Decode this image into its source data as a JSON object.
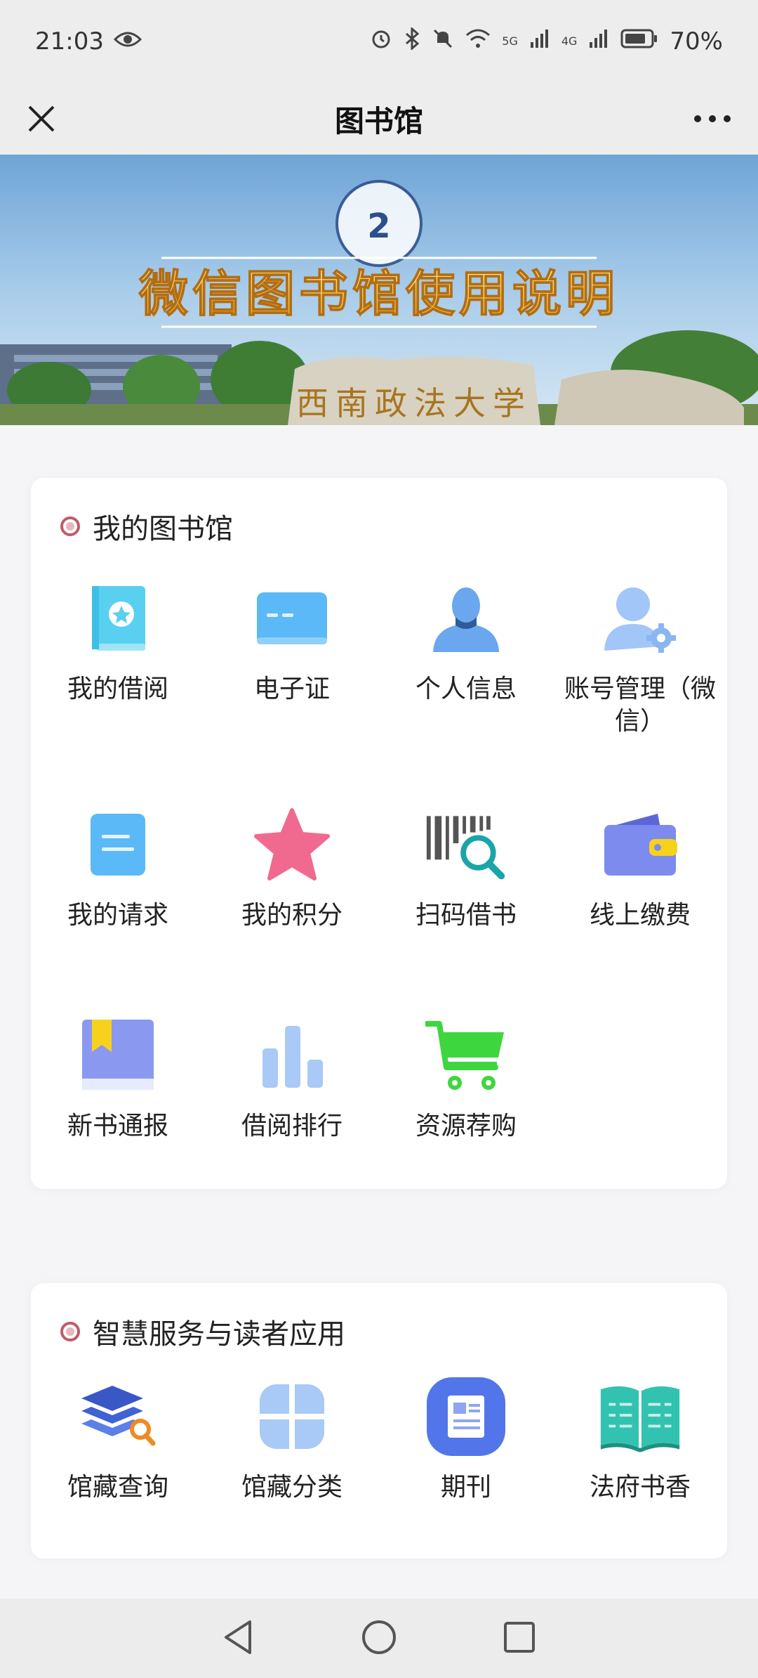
{
  "status": {
    "time": "21:03",
    "net1": "5G",
    "net2": "4G",
    "battery": "70%"
  },
  "header": {
    "title": "图书馆"
  },
  "banner": {
    "headline": "微信图书馆使用说明",
    "stone_text": "西南政法大学"
  },
  "sections": [
    {
      "title": "我的图书馆",
      "items": [
        {
          "label": "我的借阅",
          "icon": "book-icon"
        },
        {
          "label": "电子证",
          "icon": "card-icon"
        },
        {
          "label": "个人信息",
          "icon": "person-icon"
        },
        {
          "label": "账号管理（微信）",
          "icon": "user-gear-icon"
        },
        {
          "label": "我的请求",
          "icon": "document-icon"
        },
        {
          "label": "我的积分",
          "icon": "star-icon"
        },
        {
          "label": "扫码借书",
          "icon": "barcode-search-icon"
        },
        {
          "label": "线上缴费",
          "icon": "wallet-icon"
        },
        {
          "label": "新书通报",
          "icon": "bookmark-book-icon"
        },
        {
          "label": "借阅排行",
          "icon": "bar-chart-icon"
        },
        {
          "label": "资源荐购",
          "icon": "cart-icon"
        }
      ]
    },
    {
      "title": "智慧服务与读者应用",
      "items": [
        {
          "label": "馆藏查询",
          "icon": "layers-search-icon"
        },
        {
          "label": "馆藏分类",
          "icon": "grid-icon"
        },
        {
          "label": "期刊",
          "icon": "newspaper-icon"
        },
        {
          "label": "法府书香",
          "icon": "open-book-icon"
        }
      ]
    }
  ],
  "colors": {
    "accent": "#5b8def",
    "light_blue": "#6ec1f5",
    "pink": "#f06a8f",
    "green": "#3ed63e",
    "teal": "#32c3b0"
  }
}
